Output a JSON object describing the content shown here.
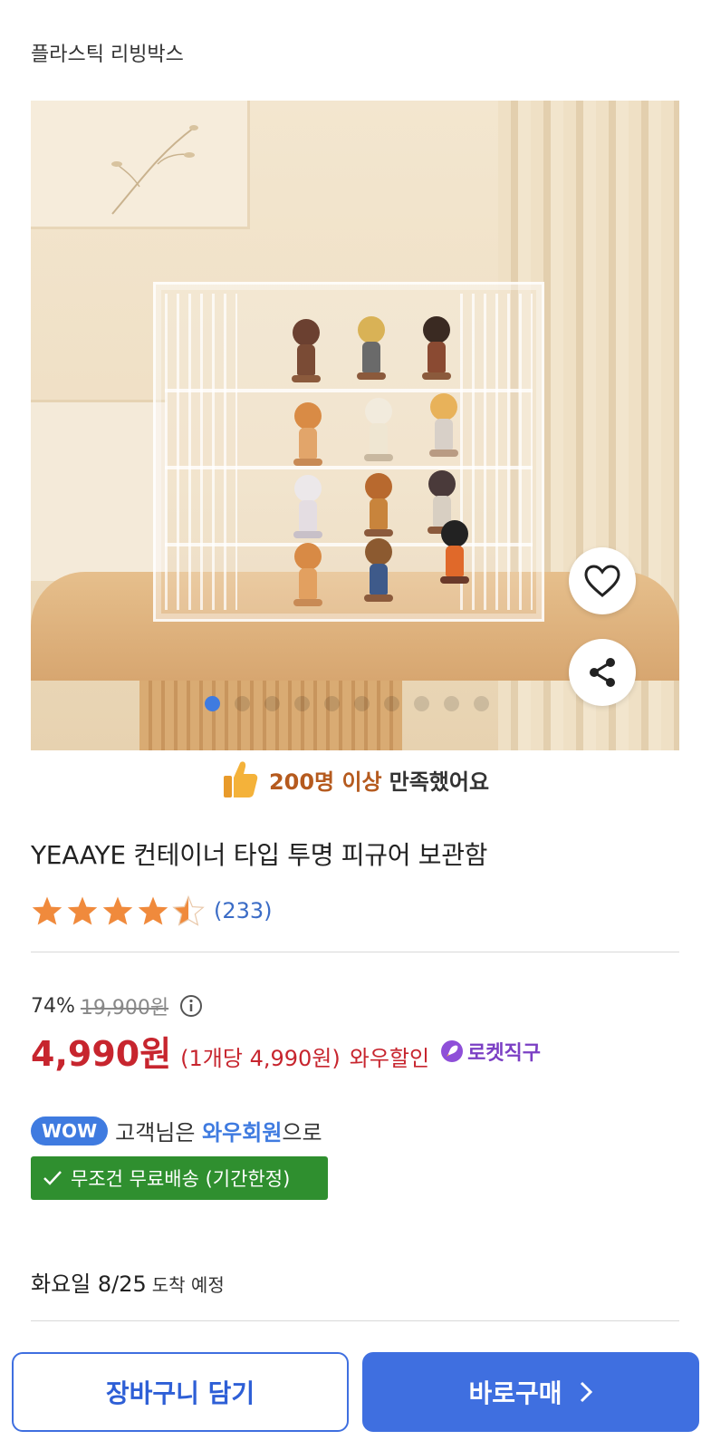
{
  "header": {
    "category": "플라스틱 리빙박스"
  },
  "gallery": {
    "image_alt": "투명 피규어 보관함 이미지",
    "page_count": 10,
    "active_index": 0,
    "icons": [
      "heart-icon",
      "share-icon"
    ]
  },
  "satisfaction": {
    "count_text": "200명 이상",
    "rest_text": "만족했어요"
  },
  "product": {
    "title": "YEAAYE 컨테이너 타입 투명 피규어 보관함",
    "rating": 4.5,
    "reviews": "(233)"
  },
  "pricing": {
    "discount": "74%",
    "original_price": "19,900원",
    "price": "4,990원",
    "unit_price": "(1개당 4,990원)",
    "wow_discount": "와우할인",
    "rocket_label": "로켓직구"
  },
  "membership": {
    "badge": "WOW",
    "prefix": "고객님은",
    "member": "와우회원",
    "suffix": "으로",
    "free_shipping": "무조건 무료배송 (기간한정)"
  },
  "delivery": {
    "date": "화요일 8/25",
    "suffix": "도착 예정"
  },
  "actions": {
    "cart": "장바구니 담기",
    "buy": "바로구매"
  },
  "colors": {
    "primary": "#3f6fe0",
    "price_red": "#c7252e",
    "green": "#2f8f2f",
    "star": "#f08a3c"
  }
}
